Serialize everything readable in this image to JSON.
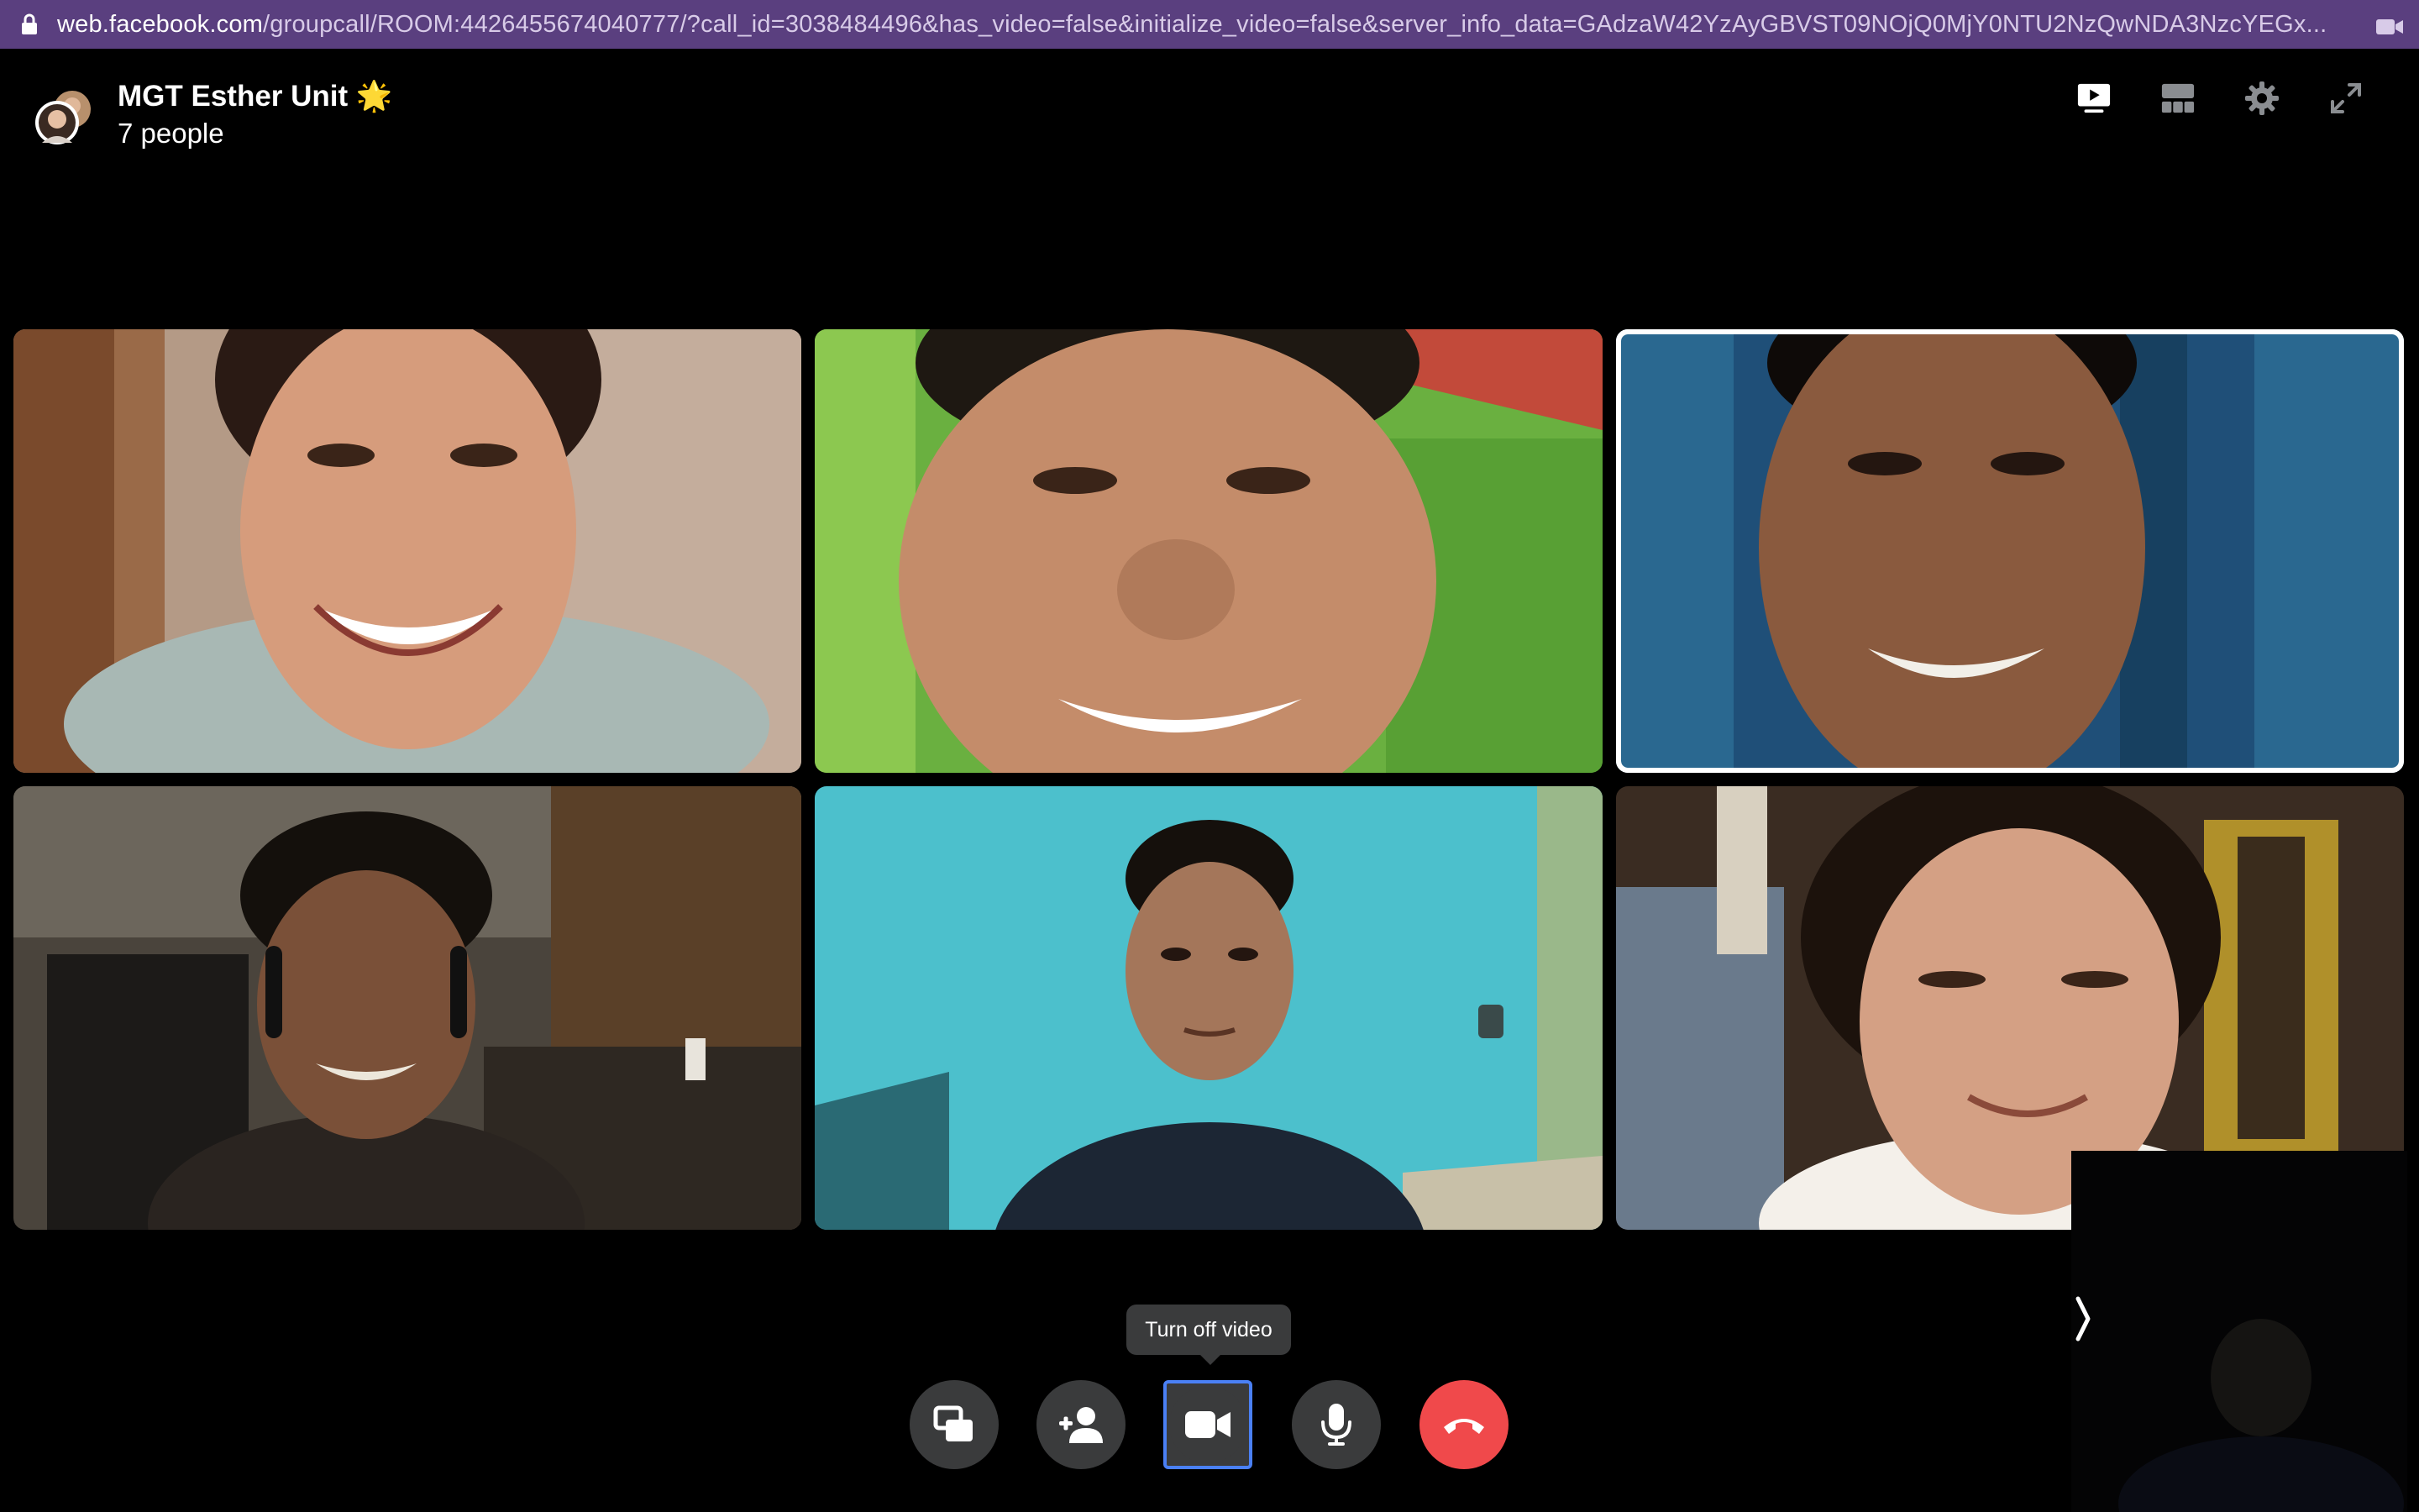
{
  "browser": {
    "url_domain": "web.facebook.com",
    "url_path": "/groupcall/ROOM:4426455674040777/?call_id=3038484496&has_video=false&initialize_video=false&server_info_data=GAdzaW42YzAyGBVST09NOjQ0MjY0NTU2NzQwNDA3NzcYEGx..."
  },
  "call": {
    "group_name": "MGT Esther Unit 🌟",
    "participants_count": "7 people"
  },
  "header_icons": [
    "screen-view-icon",
    "grid-view-icon",
    "settings-icon",
    "fullscreen-icon"
  ],
  "participants": [
    {
      "id": "participant-1",
      "active_speaker": false
    },
    {
      "id": "participant-2",
      "active_speaker": false
    },
    {
      "id": "participant-3",
      "active_speaker": true
    },
    {
      "id": "participant-4",
      "active_speaker": false
    },
    {
      "id": "participant-5",
      "active_speaker": false
    },
    {
      "id": "participant-6",
      "active_speaker": false
    }
  ],
  "tooltip": {
    "text": "Turn off video"
  },
  "controls": [
    {
      "name": "share-screen",
      "icon": "screen-share-icon"
    },
    {
      "name": "add-people",
      "icon": "add-person-icon"
    },
    {
      "name": "video",
      "icon": "video-camera-icon",
      "focused": true
    },
    {
      "name": "microphone",
      "icon": "microphone-icon"
    },
    {
      "name": "end-call",
      "icon": "end-call-icon",
      "color": "#f0494b"
    }
  ],
  "colors": {
    "url_bar": "#5a3f7f",
    "background": "#000000",
    "control_bg": "#3a3b3c",
    "end_call": "#f0494b",
    "focus_ring": "#4a80f5"
  }
}
